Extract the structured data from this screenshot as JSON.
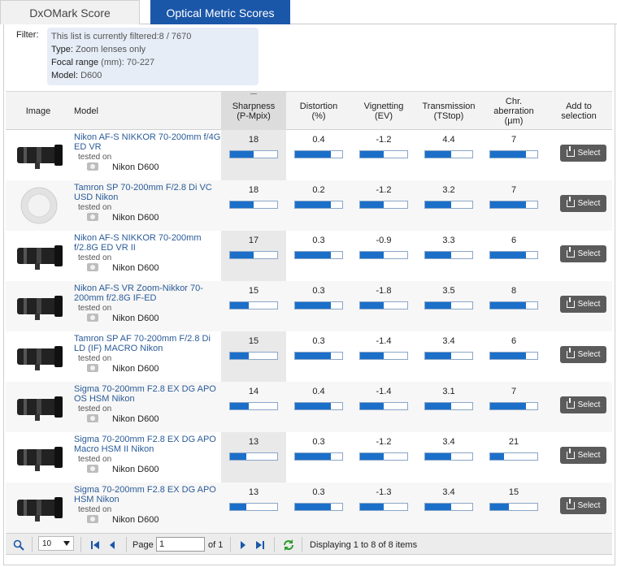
{
  "tabs": [
    {
      "label": "DxOMark Score"
    },
    {
      "label": "Optical Metric Scores"
    }
  ],
  "filter": {
    "label": "Filter:",
    "summary": "This list is currently filtered:8 / 7670",
    "type_key": "Type:",
    "type_val": "Zoom lenses only",
    "focal_key": "Focal range",
    "focal_val": "(mm): 70-227",
    "model_key": "Model:",
    "model_val": "D600"
  },
  "columns": {
    "image": "Image",
    "model": "Model",
    "sharp1": "Sharpness",
    "sharp2": "(P-Mpix)",
    "dist1": "Distortion",
    "dist2": "(%)",
    "vig1": "Vignetting",
    "vig2": "(EV)",
    "trans1": "Transmission",
    "trans2": "(TStop)",
    "chr1": "Chr.",
    "chr2": "aberration",
    "chr3": "(µm)",
    "add1": "Add to",
    "add2": "selection"
  },
  "rows": [
    {
      "model": "Nikon AF-S NIKKOR 70-200mm f/4G ED VR",
      "tested": "tested on",
      "camera": "Nikon D600",
      "sharpness": "18",
      "distortion": "0.4",
      "vignetting": "-1.2",
      "transmission": "4.4",
      "chr": "7",
      "select": "Select",
      "bars": [
        0.5,
        0.75,
        0.5,
        0.55,
        0.75
      ]
    },
    {
      "model": "Tamron SP 70-200mm F/2.8 Di VC USD Nikon",
      "tested": "tested on",
      "camera": "Nikon D600",
      "sharpness": "18",
      "distortion": "0.2",
      "vignetting": "-1.2",
      "transmission": "3.2",
      "chr": "7",
      "select": "Select",
      "bars": [
        0.5,
        0.75,
        0.5,
        0.55,
        0.75
      ]
    },
    {
      "model": "Nikon AF-S NIKKOR 70-200mm f/2.8G ED VR II",
      "tested": "tested on",
      "camera": "Nikon D600",
      "sharpness": "17",
      "distortion": "0.3",
      "vignetting": "-0.9",
      "transmission": "3.3",
      "chr": "6",
      "select": "Select",
      "bars": [
        0.5,
        0.75,
        0.5,
        0.55,
        0.75
      ]
    },
    {
      "model": "Nikon AF-S VR Zoom-Nikkor 70-200mm f/2.8G IF-ED",
      "tested": "tested on",
      "camera": "Nikon D600",
      "sharpness": "15",
      "distortion": "0.3",
      "vignetting": "-1.8",
      "transmission": "3.5",
      "chr": "8",
      "select": "Select",
      "bars": [
        0.4,
        0.75,
        0.5,
        0.55,
        0.75
      ]
    },
    {
      "model": "Tamron SP AF 70-200mm F/2.8 Di LD (IF) MACRO Nikon",
      "tested": "tested on",
      "camera": "Nikon D600",
      "sharpness": "15",
      "distortion": "0.3",
      "vignetting": "-1.4",
      "transmission": "3.4",
      "chr": "6",
      "select": "Select",
      "bars": [
        0.4,
        0.75,
        0.5,
        0.55,
        0.75
      ]
    },
    {
      "model": "Sigma 70-200mm F2.8 EX DG APO OS HSM Nikon",
      "tested": "tested on",
      "camera": "Nikon D600",
      "sharpness": "14",
      "distortion": "0.4",
      "vignetting": "-1.4",
      "transmission": "3.1",
      "chr": "7",
      "select": "Select",
      "bars": [
        0.4,
        0.75,
        0.5,
        0.55,
        0.75
      ]
    },
    {
      "model": "Sigma 70-200mm F2.8 EX DG APO Macro HSM II Nikon",
      "tested": "tested on",
      "camera": "Nikon D600",
      "sharpness": "13",
      "distortion": "0.3",
      "vignetting": "-1.2",
      "transmission": "3.4",
      "chr": "21",
      "select": "Select",
      "bars": [
        0.35,
        0.75,
        0.5,
        0.55,
        0.3
      ]
    },
    {
      "model": "Sigma 70-200mm F2.8 EX DG APO HSM Nikon",
      "tested": "tested on",
      "camera": "Nikon D600",
      "sharpness": "13",
      "distortion": "0.3",
      "vignetting": "-1.3",
      "transmission": "3.4",
      "chr": "15",
      "select": "Select",
      "bars": [
        0.35,
        0.75,
        0.5,
        0.55,
        0.4
      ]
    }
  ],
  "pager": {
    "page_size": "10",
    "page_label": "Page",
    "page_value": "1",
    "of_label": "of 1",
    "status": "Displaying 1 to 8 of 8 items"
  },
  "colors": {
    "accent": "#1b57a8",
    "bar_fill": "#1b6fc8",
    "button": "#5b5b5b"
  }
}
